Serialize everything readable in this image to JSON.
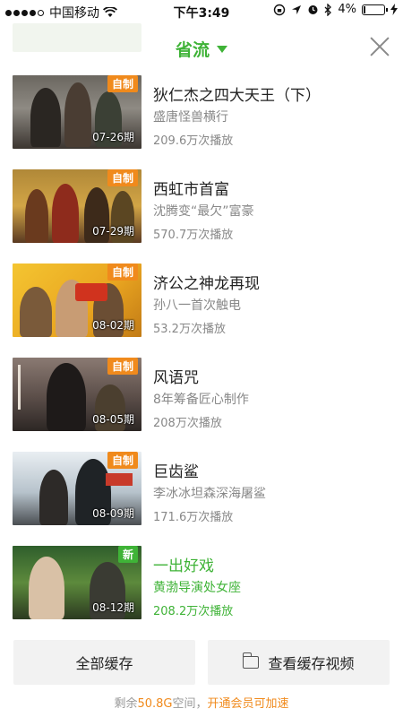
{
  "status_bar": {
    "carrier": "中国移动",
    "time": "下午3:49",
    "battery": "4%"
  },
  "header": {
    "title": "省流"
  },
  "videos": [
    {
      "title": "狄仁杰之四大天王（下）",
      "subtitle": "盛唐怪兽横行",
      "plays": "209.6万次播放",
      "tag": "自制",
      "date": "07-26期"
    },
    {
      "title": "西虹市首富",
      "subtitle": "沈腾变“最欠”富豪",
      "plays": "570.7万次播放",
      "tag": "自制",
      "date": "07-29期"
    },
    {
      "title": "济公之神龙再现",
      "subtitle": "孙八一首次触电",
      "plays": "53.2万次播放",
      "tag": "自制",
      "date": "08-02期"
    },
    {
      "title": "风语咒",
      "subtitle": "8年筹备匠心制作",
      "plays": "208万次播放",
      "tag": "自制",
      "date": "08-05期"
    },
    {
      "title": "巨齿鲨",
      "subtitle": "李冰冰坦森深海屠鲨",
      "plays": "171.6万次播放",
      "tag": "自制",
      "date": "08-09期"
    },
    {
      "title": "一出好戏",
      "subtitle": "黄渤导演处女座",
      "plays": "208.2万次播放",
      "tag": "新",
      "date": "08-12期"
    }
  ],
  "actions": {
    "download_all": "全部缓存",
    "view_downloads": "查看缓存视频"
  },
  "storage": {
    "prefix": "剩余",
    "amount": "50.8G",
    "suffix": "空间，",
    "upsell": "开通会员可加速"
  },
  "colors": {
    "accent_green": "#3fb337",
    "tag_orange": "#f08a1c",
    "muted_text": "#888888"
  }
}
